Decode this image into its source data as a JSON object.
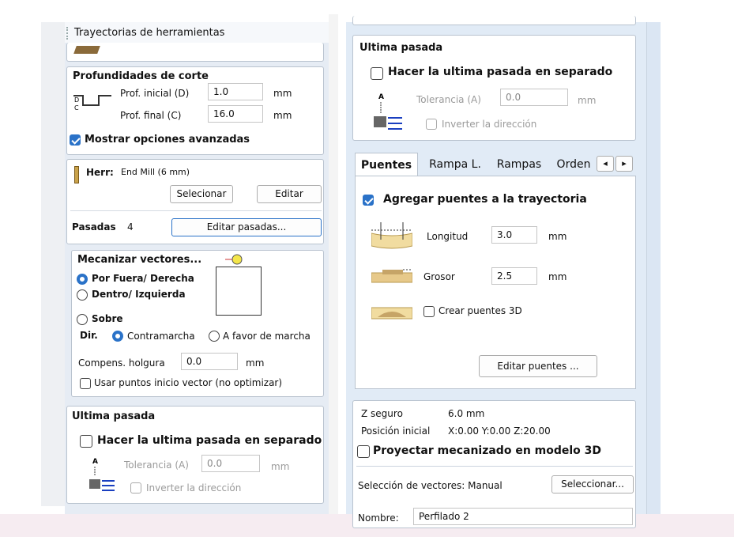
{
  "left_panel": {
    "title": "Trayectorias de herramientas",
    "depths": {
      "heading": "Profundidades de corte",
      "start_label": "Prof. inicial (D)",
      "start_value": "1.0",
      "start_unit": "mm",
      "end_label": "Prof. final (C)",
      "end_value": "16.0",
      "end_unit": "mm",
      "advanced_label": "Mostrar opciones avanzadas",
      "advanced_checked": true
    },
    "tool": {
      "label": "Herr:",
      "name": "End Mill (6 mm)",
      "select_btn": "Selecionar",
      "edit_btn": "Editar",
      "passes_label": "Pasadas",
      "passes_value": "4",
      "edit_passes_btn": "Editar pasadas..."
    },
    "machine": {
      "heading": "Mecanizar vectores...",
      "outside": "Por Fuera/ Derecha",
      "inside": "Dentro/ Izquierda",
      "on": "Sobre",
      "dir_label": "Dir.",
      "climb": "Contramarcha",
      "conventional": "A favor de marcha",
      "allowance_label": "Compens. holgura",
      "allowance_value": "0.0",
      "allowance_unit": "mm",
      "start_points": "Usar puntos inicio vector (no optimizar)"
    },
    "last_pass": {
      "heading": "Ultima pasada",
      "separate": "Hacer la ultima pasada en separado",
      "tol_label": "Tolerancia (A)",
      "tol_value": "0.0",
      "tol_unit": "mm",
      "reverse": "Inverter la dirección"
    }
  },
  "right_panel": {
    "last_pass": {
      "heading": "Ultima pasada",
      "separate": "Hacer la ultima pasada en separado",
      "tol_label": "Tolerancia (A)",
      "tol_value": "0.0",
      "tol_unit": "mm",
      "reverse": "Inverter la dirección"
    },
    "tabs": [
      "Puentes",
      "Rampa L.",
      "Rampas",
      "Orden"
    ],
    "tab_arrows": {
      "left": "◂",
      "right": "▸"
    },
    "bridges": {
      "add_label": "Agregar puentes a la trayectoria",
      "add_checked": true,
      "length_label": "Longitud",
      "length_value": "3.0",
      "length_unit": "mm",
      "thickness_label": "Grosor",
      "thickness_value": "2.5",
      "thickness_unit": "mm",
      "create3d": "Crear puentes 3D",
      "edit_btn": "Editar puentes ..."
    },
    "info": {
      "safe_z_label": "Z seguro",
      "safe_z_value": "6.0 mm",
      "home_label": "Posición inicial",
      "home_value": "X:0.00 Y:0.00 Z:20.00",
      "project_label": "Proyectar mecanizado en modelo 3D",
      "vector_sel_label": "Selección de vectores: Manual",
      "vector_sel_btn": "Seleccionar...",
      "name_label": "Nombre:",
      "name_value": "Perfilado 2"
    }
  },
  "colors": {
    "accent": "#2a72c8",
    "panel_bg": "#e1ebf6",
    "bottom_band": "#f6ecf1"
  }
}
